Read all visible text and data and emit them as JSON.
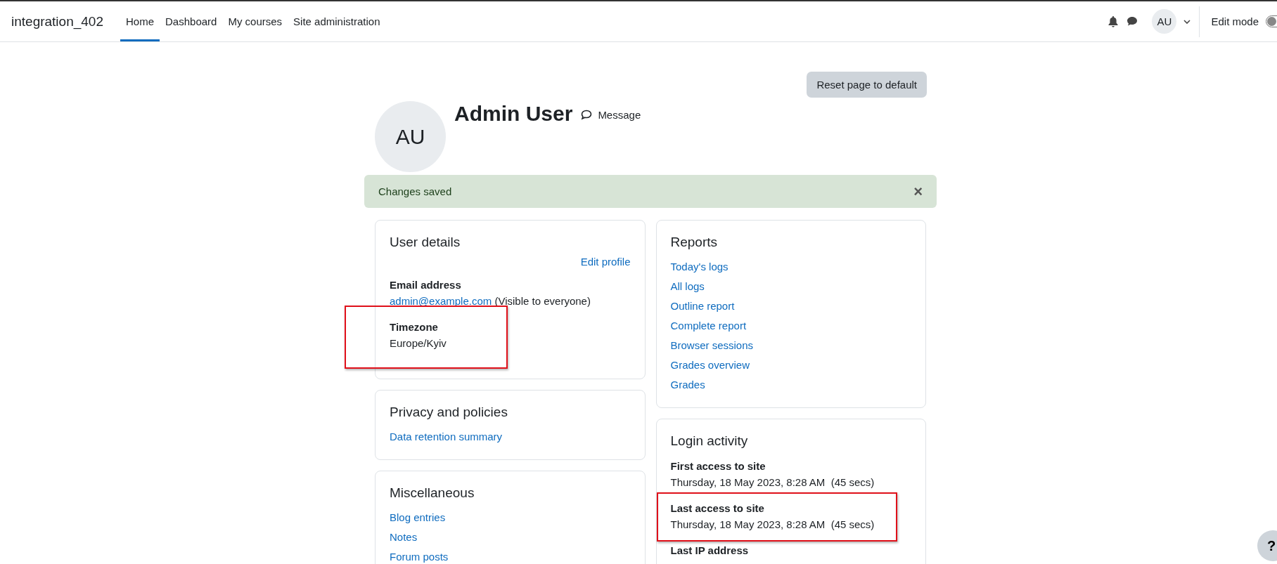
{
  "navbar": {
    "site_name": "integration_402",
    "links": [
      {
        "label": "Home",
        "selected": true
      },
      {
        "label": "Dashboard",
        "selected": false
      },
      {
        "label": "My courses",
        "selected": false
      },
      {
        "label": "Site administration",
        "selected": false
      }
    ],
    "user_initials": "AU",
    "edit_mode": {
      "label": "Edit mode",
      "on": false
    }
  },
  "reset_button": "Reset page to default",
  "profile": {
    "initials": "AU",
    "name": "Admin User",
    "message_link": "Message"
  },
  "alert": {
    "text": "Changes saved",
    "close": "×"
  },
  "left_cards": [
    {
      "title": "User details",
      "edit_link": "Edit profile",
      "fields": [
        {
          "label": "Email address",
          "link": "admin@example.com",
          "note": "(Visible to everyone)",
          "highlighted": false
        },
        {
          "label": "Timezone",
          "value": "Europe/Kyiv",
          "highlighted": true
        }
      ]
    },
    {
      "title": "Privacy and policies",
      "links": [
        "Data retention summary"
      ]
    },
    {
      "title": "Miscellaneous",
      "links": [
        "Blog entries",
        "Notes",
        "Forum posts"
      ]
    }
  ],
  "right_cards": [
    {
      "title": "Reports",
      "links": [
        "Today's logs",
        "All logs",
        "Outline report",
        "Complete report",
        "Browser sessions",
        "Grades overview",
        "Grades"
      ]
    },
    {
      "title": "Login activity",
      "fields": [
        {
          "label": "First access to site",
          "value": "Thursday, 18 May 2023, 8:28 AM  (45 secs)",
          "highlighted": false
        },
        {
          "label": "Last access to site",
          "value": "Thursday, 18 May 2023, 8:28 AM  (45 secs)",
          "highlighted": true
        },
        {
          "label": "Last IP address",
          "highlighted": false
        }
      ]
    }
  ],
  "help_button": "?"
}
